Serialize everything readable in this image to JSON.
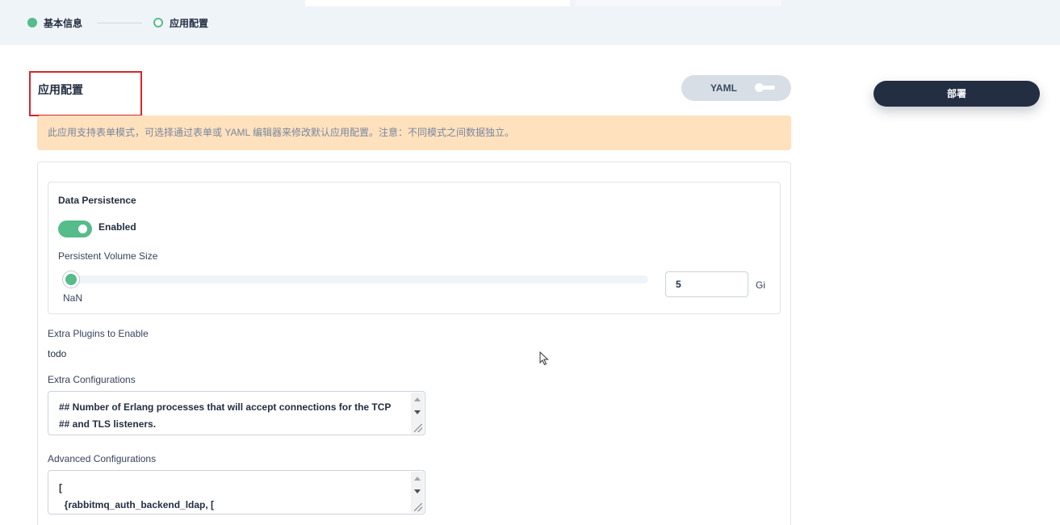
{
  "stepper": {
    "steps": [
      {
        "label": "基本信息",
        "state": "done"
      },
      {
        "label": "应用配置",
        "state": "current"
      }
    ]
  },
  "section": {
    "title": "应用配置"
  },
  "yaml_toggle": {
    "label": "YAML",
    "enabled": false
  },
  "deploy_button": {
    "label": "部署"
  },
  "notice": {
    "text": "此应用支持表单模式，可选择通过表单或 YAML 编辑器来修改默认应用配置。注意：不同模式之间数据独立。"
  },
  "persistence": {
    "title": "Data Persistence",
    "switch_label": "Enabled",
    "enabled": true,
    "volume_label": "Persistent Volume Size",
    "slider_value_label": "NaN",
    "size_value": "5",
    "size_unit": "Gi"
  },
  "plugins": {
    "label": "Extra Plugins to Enable",
    "value": "todo"
  },
  "extra_config": {
    "label": "Extra Configurations",
    "value": "## Number of Erlang processes that will accept connections for the TCP\n## and TLS listeners."
  },
  "advanced_config": {
    "label": "Advanced Configurations",
    "value": "[\n  {rabbitmq_auth_backend_ldap, ["
  },
  "colors": {
    "accent": "#55bc8a",
    "dark": "#242e42",
    "notice_bg": "#ffe1be",
    "highlight": "#d7262b"
  }
}
